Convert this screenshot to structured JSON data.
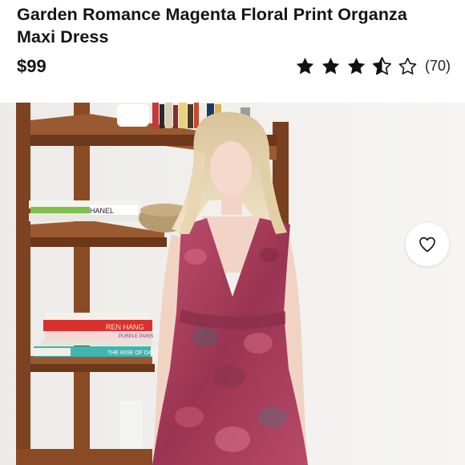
{
  "product": {
    "title": "Garden Romance Magenta Floral Print Organza Maxi Dress",
    "price": "$99",
    "rating": 3.5,
    "rating_max": 5,
    "review_count": "(70)"
  },
  "photo": {
    "book_spines": [
      "HANEL",
      "REN HANG",
      "PURPLE PARIS",
      "THE RISE OF DAVID"
    ]
  },
  "colors": {
    "shelf_wood": "#8a4a24",
    "dress_magenta": "#b23a62",
    "accent_text": "#141414"
  },
  "icons": {
    "favorite": "heart-outline-icon",
    "star": "star-icon"
  }
}
